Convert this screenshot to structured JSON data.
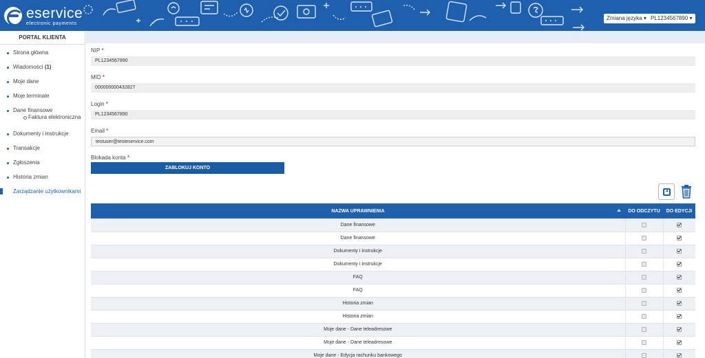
{
  "header": {
    "brand_name": "eservice",
    "brand_tagline": "electronic payments",
    "language_button": "Zmiana języka",
    "account_button": "PL1234567890"
  },
  "sidebar": {
    "title": "PORTAL KLIENTA",
    "items": [
      {
        "label": "Strona główna"
      },
      {
        "label": "Wiadomości",
        "badge": "(1)"
      },
      {
        "label": "Moje dane"
      },
      {
        "label": "Moje terminale"
      },
      {
        "label": "Dane finansowe",
        "sub": "Faktura elektroniczna"
      },
      {
        "label": "Dokumenty i instrukcje"
      },
      {
        "label": "Transakcje"
      },
      {
        "label": "Zgłoszenia"
      },
      {
        "label": "Historia zmian"
      },
      {
        "label": "Zarządzanie użytkownikami",
        "active": true
      }
    ]
  },
  "form": {
    "nip": {
      "label": "NIP",
      "required": "*",
      "value": "PL1234567890"
    },
    "mid": {
      "label": "MID",
      "required": "*",
      "value": "000000000432827"
    },
    "login": {
      "label": "Login",
      "required": "*",
      "value": "PL1234567890"
    },
    "email": {
      "label": "Email",
      "required": "*",
      "value": "testuser@testeservice.com"
    },
    "lock": {
      "label": "Blokada konta",
      "required": "*",
      "button": "ZABLOKUJ KONTO"
    }
  },
  "table": {
    "headers": {
      "name": "NAZWA UPRAWNIENIA",
      "read": "DO ODCZYTU",
      "edit": "DO EDYCJI"
    },
    "rows": [
      {
        "name": "Dane finansowe",
        "read": false,
        "edit": true
      },
      {
        "name": "Dane finansowe",
        "read": false,
        "edit": true
      },
      {
        "name": "Dokumenty i instrukcje",
        "read": false,
        "edit": true
      },
      {
        "name": "Dokumenty i instrukcje",
        "read": false,
        "edit": true
      },
      {
        "name": "FAQ",
        "read": false,
        "edit": true
      },
      {
        "name": "FAQ",
        "read": false,
        "edit": true
      },
      {
        "name": "Historia zmian",
        "read": false,
        "edit": true
      },
      {
        "name": "Historia zmian",
        "read": false,
        "edit": true
      },
      {
        "name": "Moje dane - Dane teleadresowe",
        "read": false,
        "edit": true
      },
      {
        "name": "Moje dane - Dane teleadresowe",
        "read": false,
        "edit": true
      },
      {
        "name": "Moje dane - Edycja rachunku bankowego",
        "read": false,
        "edit": true
      }
    ]
  },
  "colors": {
    "brand_blue": "#1e5fae",
    "row_alt": "#edf0f4"
  }
}
